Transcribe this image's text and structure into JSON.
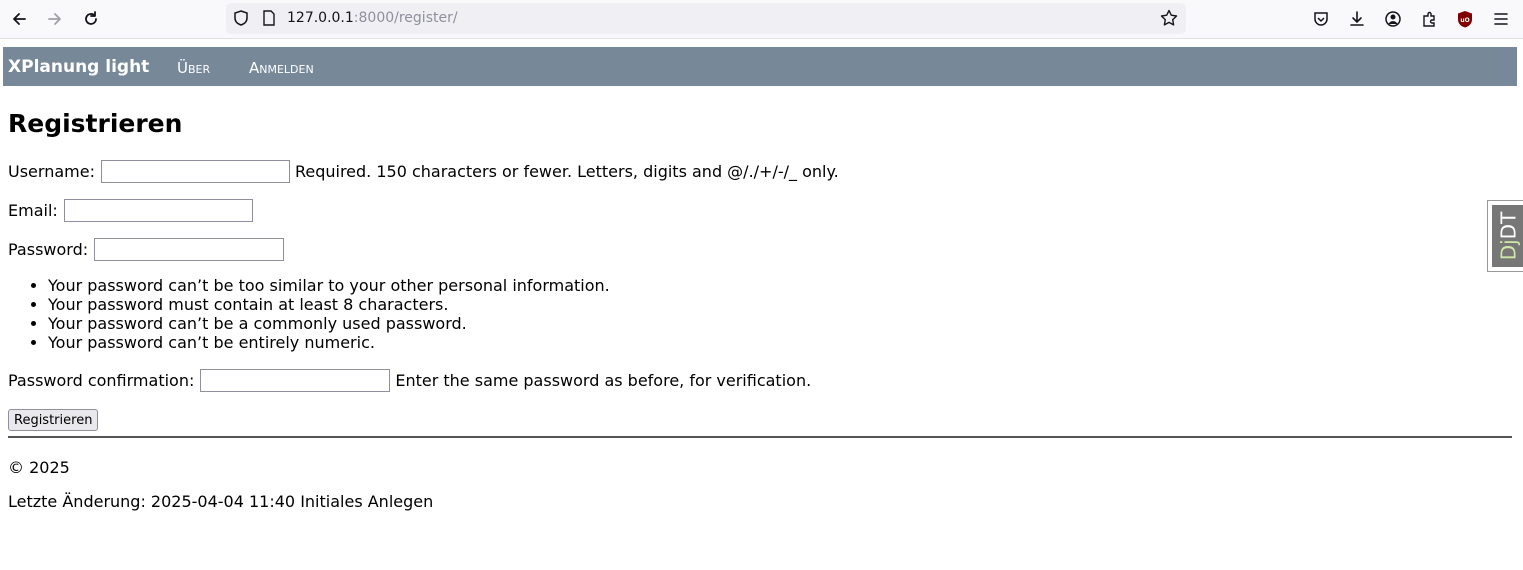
{
  "browser": {
    "url_host": "127.0.0.1",
    "url_rest": ":8000/register/",
    "icons": [
      "back-arrow-icon",
      "forward-arrow-icon",
      "reload-icon",
      "shield-icon",
      "page-icon",
      "star-icon",
      "pocket-icon",
      "download-icon",
      "account-icon",
      "extensions-icon",
      "ublock-icon",
      "menu-icon"
    ]
  },
  "nav": {
    "brand": "XPlanung light",
    "links": [
      "Über",
      "Anmelden"
    ],
    "color": "#778899"
  },
  "page": {
    "title": "Registrieren",
    "username": {
      "label": "Username:",
      "help": "Required. 150 characters or fewer. Letters, digits and @/./+/-/_ only.",
      "value": ""
    },
    "email": {
      "label": "Email:",
      "value": ""
    },
    "password": {
      "label": "Password:",
      "value": ""
    },
    "password_rules": [
      "Your password can’t be too similar to your other personal information.",
      "Your password must contain at least 8 characters.",
      "Your password can’t be a commonly used password.",
      "Your password can’t be entirely numeric."
    ],
    "password_confirm": {
      "label": "Password confirmation:",
      "help": "Enter the same password as before, for verification.",
      "value": ""
    },
    "submit_label": "Registrieren"
  },
  "footer": {
    "copyright": "© 2025",
    "last_change": "Letzte Änderung: 2025-04-04 11:40 Initiales Anlegen"
  },
  "toolbar_widget": {
    "dj": "Dj",
    "dt": "DT"
  }
}
